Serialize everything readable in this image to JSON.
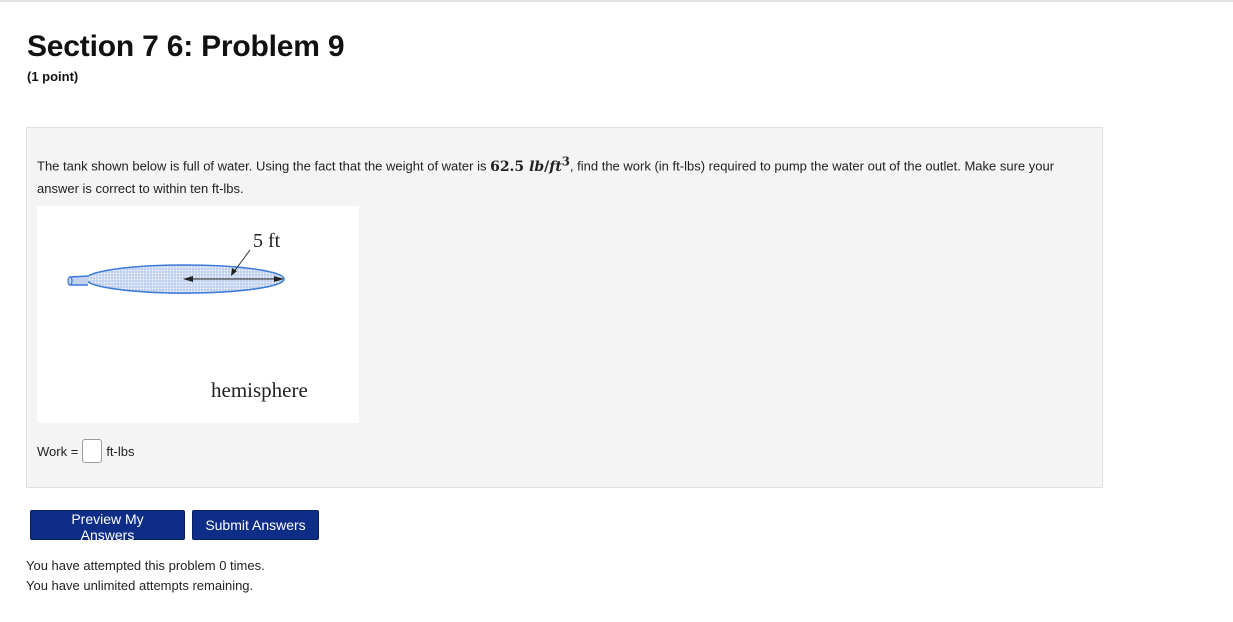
{
  "header": {
    "title": "Section 7 6: Problem 9",
    "points": "(1 point)"
  },
  "problem": {
    "statement_before": "The tank shown below is full of water. Using the fact that the weight of water is ",
    "weight_value": "62.5",
    "unit_lb": "lb",
    "unit_ft": "ft",
    "unit_exp": "3",
    "statement_after": ", find the work (in ft-lbs) required to pump the water out of the outlet. Make sure your answer is correct to within ten ft-lbs.",
    "figure": {
      "radius_label": "5 ft",
      "shape_label": "hemisphere",
      "colors": {
        "fill": "#c3d3ef",
        "stroke": "#3d7bd9",
        "dot": "#ffffff"
      }
    },
    "answer": {
      "label": "Work =",
      "value": "",
      "unit": "ft-lbs"
    }
  },
  "buttons": {
    "preview": "Preview My Answers",
    "submit": "Submit Answers"
  },
  "status": {
    "attempted": "You have attempted this problem 0 times.",
    "remaining": "You have unlimited attempts remaining."
  },
  "colors": {
    "button_bg": "#0e2d87",
    "panel_bg": "#f4f4f4"
  }
}
